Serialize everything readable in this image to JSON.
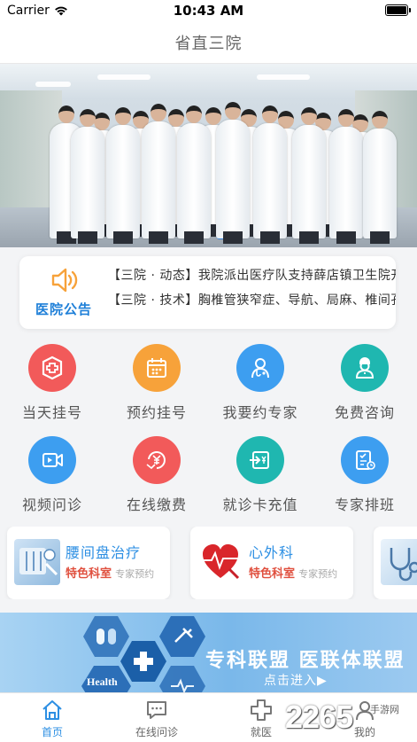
{
  "status_bar": {
    "carrier": "Carrier",
    "time": "10:43 AM",
    "battery_level": 1.0
  },
  "nav": {
    "title": "省直三院"
  },
  "banner": {
    "slide_count": 3,
    "active_slide": 2
  },
  "notice": {
    "logo_text": "医院公告",
    "items": [
      "【三院 · 动态】我院派出医疗队支持薛店镇卫生院开",
      "【三院 · 技术】胸椎管狭窄症、导航、局麻、椎间孔"
    ]
  },
  "services": [
    {
      "label": "当天挂号",
      "icon": "same-day-registration-icon",
      "color": "#f25a5a"
    },
    {
      "label": "预约挂号",
      "icon": "calendar-icon",
      "color": "#f7a23a"
    },
    {
      "label": "我要约专家",
      "icon": "doctor-icon",
      "color": "#3d9ef0"
    },
    {
      "label": "免费咨询",
      "icon": "nurse-consult-icon",
      "color": "#1fb7b0"
    },
    {
      "label": "视频问诊",
      "icon": "video-icon",
      "color": "#3d9ef0"
    },
    {
      "label": "在线缴费",
      "icon": "payment-icon",
      "color": "#f25a5a"
    },
    {
      "label": "就诊卡充值",
      "icon": "card-recharge-icon",
      "color": "#1fb7b0"
    },
    {
      "label": "专家排班",
      "icon": "schedule-icon",
      "color": "#3d9ef0"
    }
  ],
  "departments": [
    {
      "title": "腰间盘治疗",
      "tag": "特色科室",
      "action": "专家预约"
    },
    {
      "title": "心外科",
      "tag": "特色科室",
      "action": "专家预约"
    }
  ],
  "alliance": {
    "title": "专科联盟  医联体联盟",
    "cta": "点击进入▶",
    "health_label": "Health"
  },
  "tabs": [
    {
      "label": "首页",
      "icon": "home-icon",
      "active": true
    },
    {
      "label": "在线问诊",
      "icon": "chat-icon",
      "active": false
    },
    {
      "label": "就医",
      "icon": "medical-cross-icon",
      "active": false
    },
    {
      "label": "我的",
      "icon": "user-icon",
      "active": false
    }
  ],
  "watermark": {
    "number": "2265",
    "site": "手游网"
  },
  "colors": {
    "accent": "#2d8fe3",
    "tag_red": "#e0503f"
  }
}
